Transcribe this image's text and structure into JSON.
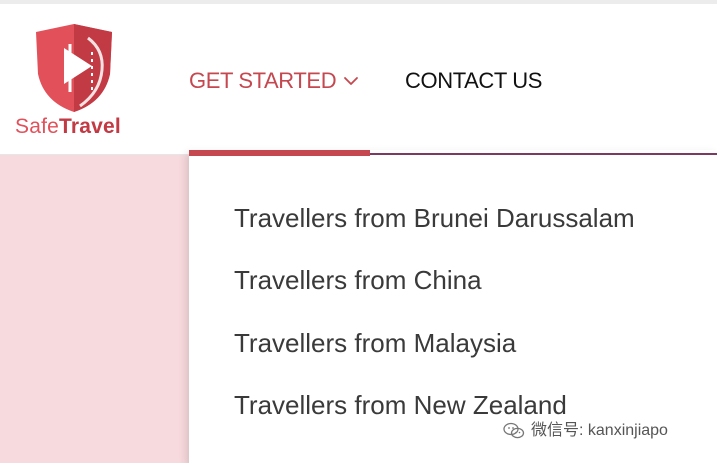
{
  "brand": {
    "word_part1": "Safe",
    "word_part2": "Travel",
    "colors": {
      "primary": "#e2505a",
      "dark": "#c23a43",
      "accent_border": "#7b3a62",
      "background_pink": "#f7dadd"
    }
  },
  "nav": {
    "get_started_label": "GET STARTED",
    "contact_label": "CONTACT US",
    "dropdown_icon": "chevron-down-icon"
  },
  "dropdown": {
    "items": [
      "Travellers from Brunei Darussalam",
      "Travellers from China",
      "Travellers from Malaysia",
      "Travellers from New Zealand"
    ]
  },
  "watermark": {
    "icon": "wechat-icon",
    "text": "微信号: kanxinjiapo"
  }
}
